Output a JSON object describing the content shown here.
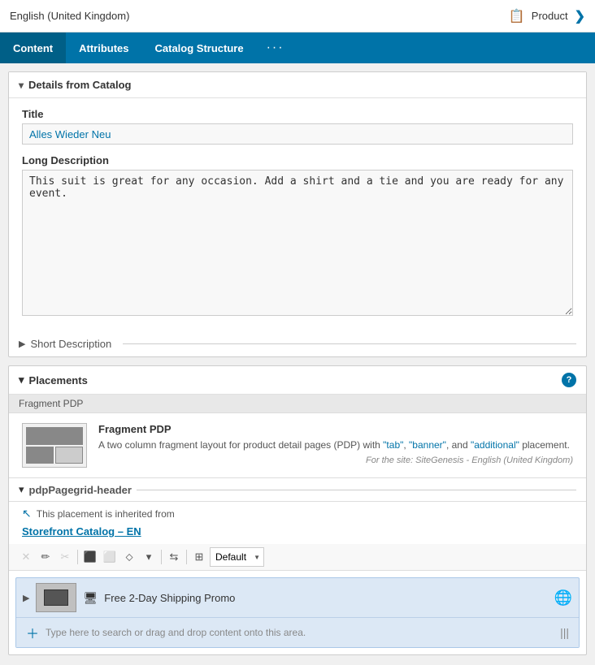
{
  "topbar": {
    "locale": "English (United Kingdom)",
    "product_label": "Product",
    "book_icon": "📋",
    "chevron_right": "❯"
  },
  "nav": {
    "tabs": [
      {
        "id": "content",
        "label": "Content",
        "active": true
      },
      {
        "id": "attributes",
        "label": "Attributes",
        "active": false
      },
      {
        "id": "catalog-structure",
        "label": "Catalog Structure",
        "active": false
      }
    ],
    "more": "···"
  },
  "details_section": {
    "label": "Details from Catalog",
    "chevron": "▾",
    "title_label": "Title",
    "title_value": "Alles Wieder Neu",
    "long_desc_label": "Long Description",
    "long_desc_value": "This suit is great for any occasion. Add a shirt and a tie and you are ready for any event.",
    "short_desc_label": "Short Description"
  },
  "placements_section": {
    "label": "Placements",
    "chevron": "▾",
    "help": "?",
    "fragment_label_row": "Fragment PDP",
    "fragment_title": "Fragment PDP",
    "fragment_desc_pre": "A two column fragment layout for product detail pages (PDP) with ",
    "fragment_desc_quoted1": "\"tab\"",
    "fragment_desc_mid1": ", ",
    "fragment_desc_quoted2": "\"banner\"",
    "fragment_desc_mid2": ", and ",
    "fragment_desc_quoted3": "\"additional\"",
    "fragment_desc_post": " placement.",
    "fragment_site": "For the site: SiteGenesis - English (United Kingdom)",
    "pdpgrid_label": "pdpPagegrid-header",
    "inherited_text": "This placement is inherited from",
    "inherited_link": "Storefront Catalog – EN",
    "toolbar_default": "Default",
    "toolbar_select_options": [
      "Default"
    ],
    "content_item_label": "Free 2-Day Shipping Promo",
    "add_placeholder": "Type here to search or drag and drop content onto this area."
  }
}
